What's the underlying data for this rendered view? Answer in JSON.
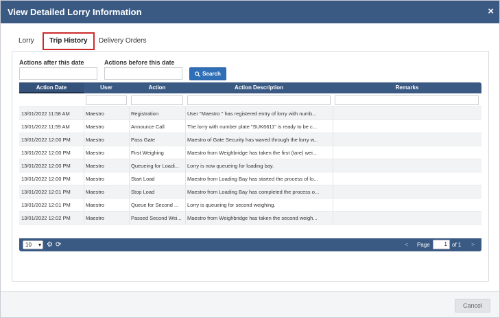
{
  "dialog": {
    "title": "View Detailed Lorry Information",
    "close_icon": "×"
  },
  "tabs": [
    {
      "label": "Lorry"
    },
    {
      "label": "Trip History"
    },
    {
      "label": "Delivery Orders"
    }
  ],
  "filters": {
    "after_label": "Actions after this date",
    "before_label": "Actions before this date",
    "search_label": "Search",
    "search_icon": "search-icon"
  },
  "grid": {
    "columns": [
      "Action Date",
      "User",
      "Action",
      "Action Description",
      "Remarks"
    ],
    "rows": [
      {
        "date": "13/01/2022 11:58 AM",
        "user": "Maestro",
        "action": "Registration",
        "desc": "User \"Maestro \" has registered entry of lorry with numb...",
        "remarks": ""
      },
      {
        "date": "13/01/2022 11:59 AM",
        "user": "Maestro",
        "action": "Announce Call",
        "desc": "The lorry with number plate \"SUK6611\" is ready to be c...",
        "remarks": ""
      },
      {
        "date": "13/01/2022 12:00 PM",
        "user": "Maestro",
        "action": "Pass Gate",
        "desc": "Maestro of Gate Security has waved through the lorry w...",
        "remarks": ""
      },
      {
        "date": "13/01/2022 12:00 PM",
        "user": "Maestro",
        "action": "First Weighing",
        "desc": "Maestro from Weighbridge has taken the first (tare) wei...",
        "remarks": ""
      },
      {
        "date": "13/01/2022 12:00 PM",
        "user": "Maestro",
        "action": "Queueing for Loadi...",
        "desc": "Lorry is now queueing for loading bay.",
        "remarks": ""
      },
      {
        "date": "13/01/2022 12:00 PM",
        "user": "Maestro",
        "action": "Start Load",
        "desc": "Maestro from Loading Bay has started the process of lo...",
        "remarks": ""
      },
      {
        "date": "13/01/2022 12:01 PM",
        "user": "Maestro",
        "action": "Stop Load",
        "desc": "Maestro from Loading Bay has completed the process o...",
        "remarks": ""
      },
      {
        "date": "13/01/2022 12:01 PM",
        "user": "Maestro",
        "action": "Queue for Second ...",
        "desc": "Lorry is queueing for second weighing.",
        "remarks": ""
      },
      {
        "date": "13/01/2022 12:02 PM",
        "user": "Maestro",
        "action": "Passed Second Wei...",
        "desc": "Maestro from Weighbridge has taken the second weigh...",
        "remarks": ""
      }
    ]
  },
  "pager": {
    "page_size": "10",
    "page_label": "Page",
    "page_value": "1",
    "of_label": "of 1",
    "prev_icon": "<",
    "next_icon": ">"
  },
  "footer": {
    "cancel_label": "Cancel"
  },
  "colors": {
    "header": "#3a5a84",
    "search_button": "#2f6fb7",
    "active_tab_border": "#cc2a2a"
  }
}
